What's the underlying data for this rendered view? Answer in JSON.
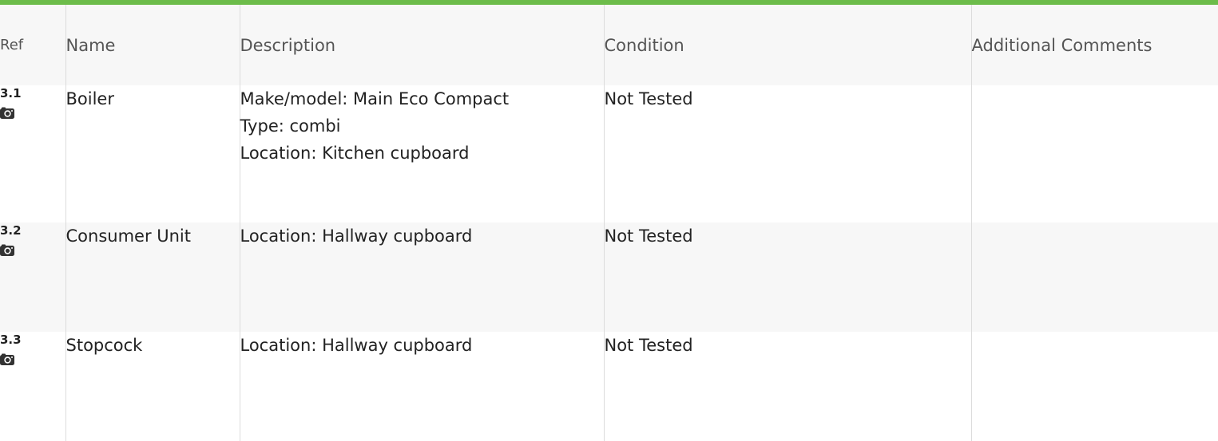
{
  "columns": {
    "ref": "Ref",
    "name": "Name",
    "description": "Description",
    "condition": "Condition",
    "comments": "Additional Comments"
  },
  "rows": [
    {
      "ref": "3.1",
      "name": "Boiler",
      "description": [
        "Make/model: Main Eco Compact",
        "Type: combi",
        "Location: Kitchen cupboard"
      ],
      "condition": "Not Tested",
      "comments": "",
      "icon": "camera-icon"
    },
    {
      "ref": "3.2",
      "name": "Consumer Unit",
      "description": [
        "Location: Hallway cupboard"
      ],
      "condition": "Not Tested",
      "comments": "",
      "icon": "camera-icon"
    },
    {
      "ref": "3.3",
      "name": "Stopcock",
      "description": [
        "Location: Hallway cupboard"
      ],
      "condition": "Not Tested",
      "comments": "",
      "icon": "camera-icon"
    }
  ],
  "colors": {
    "accent_bar": "#6cbc4a",
    "header_bg": "#f7f7f7",
    "row_alt_bg": "#f7f7f7"
  }
}
